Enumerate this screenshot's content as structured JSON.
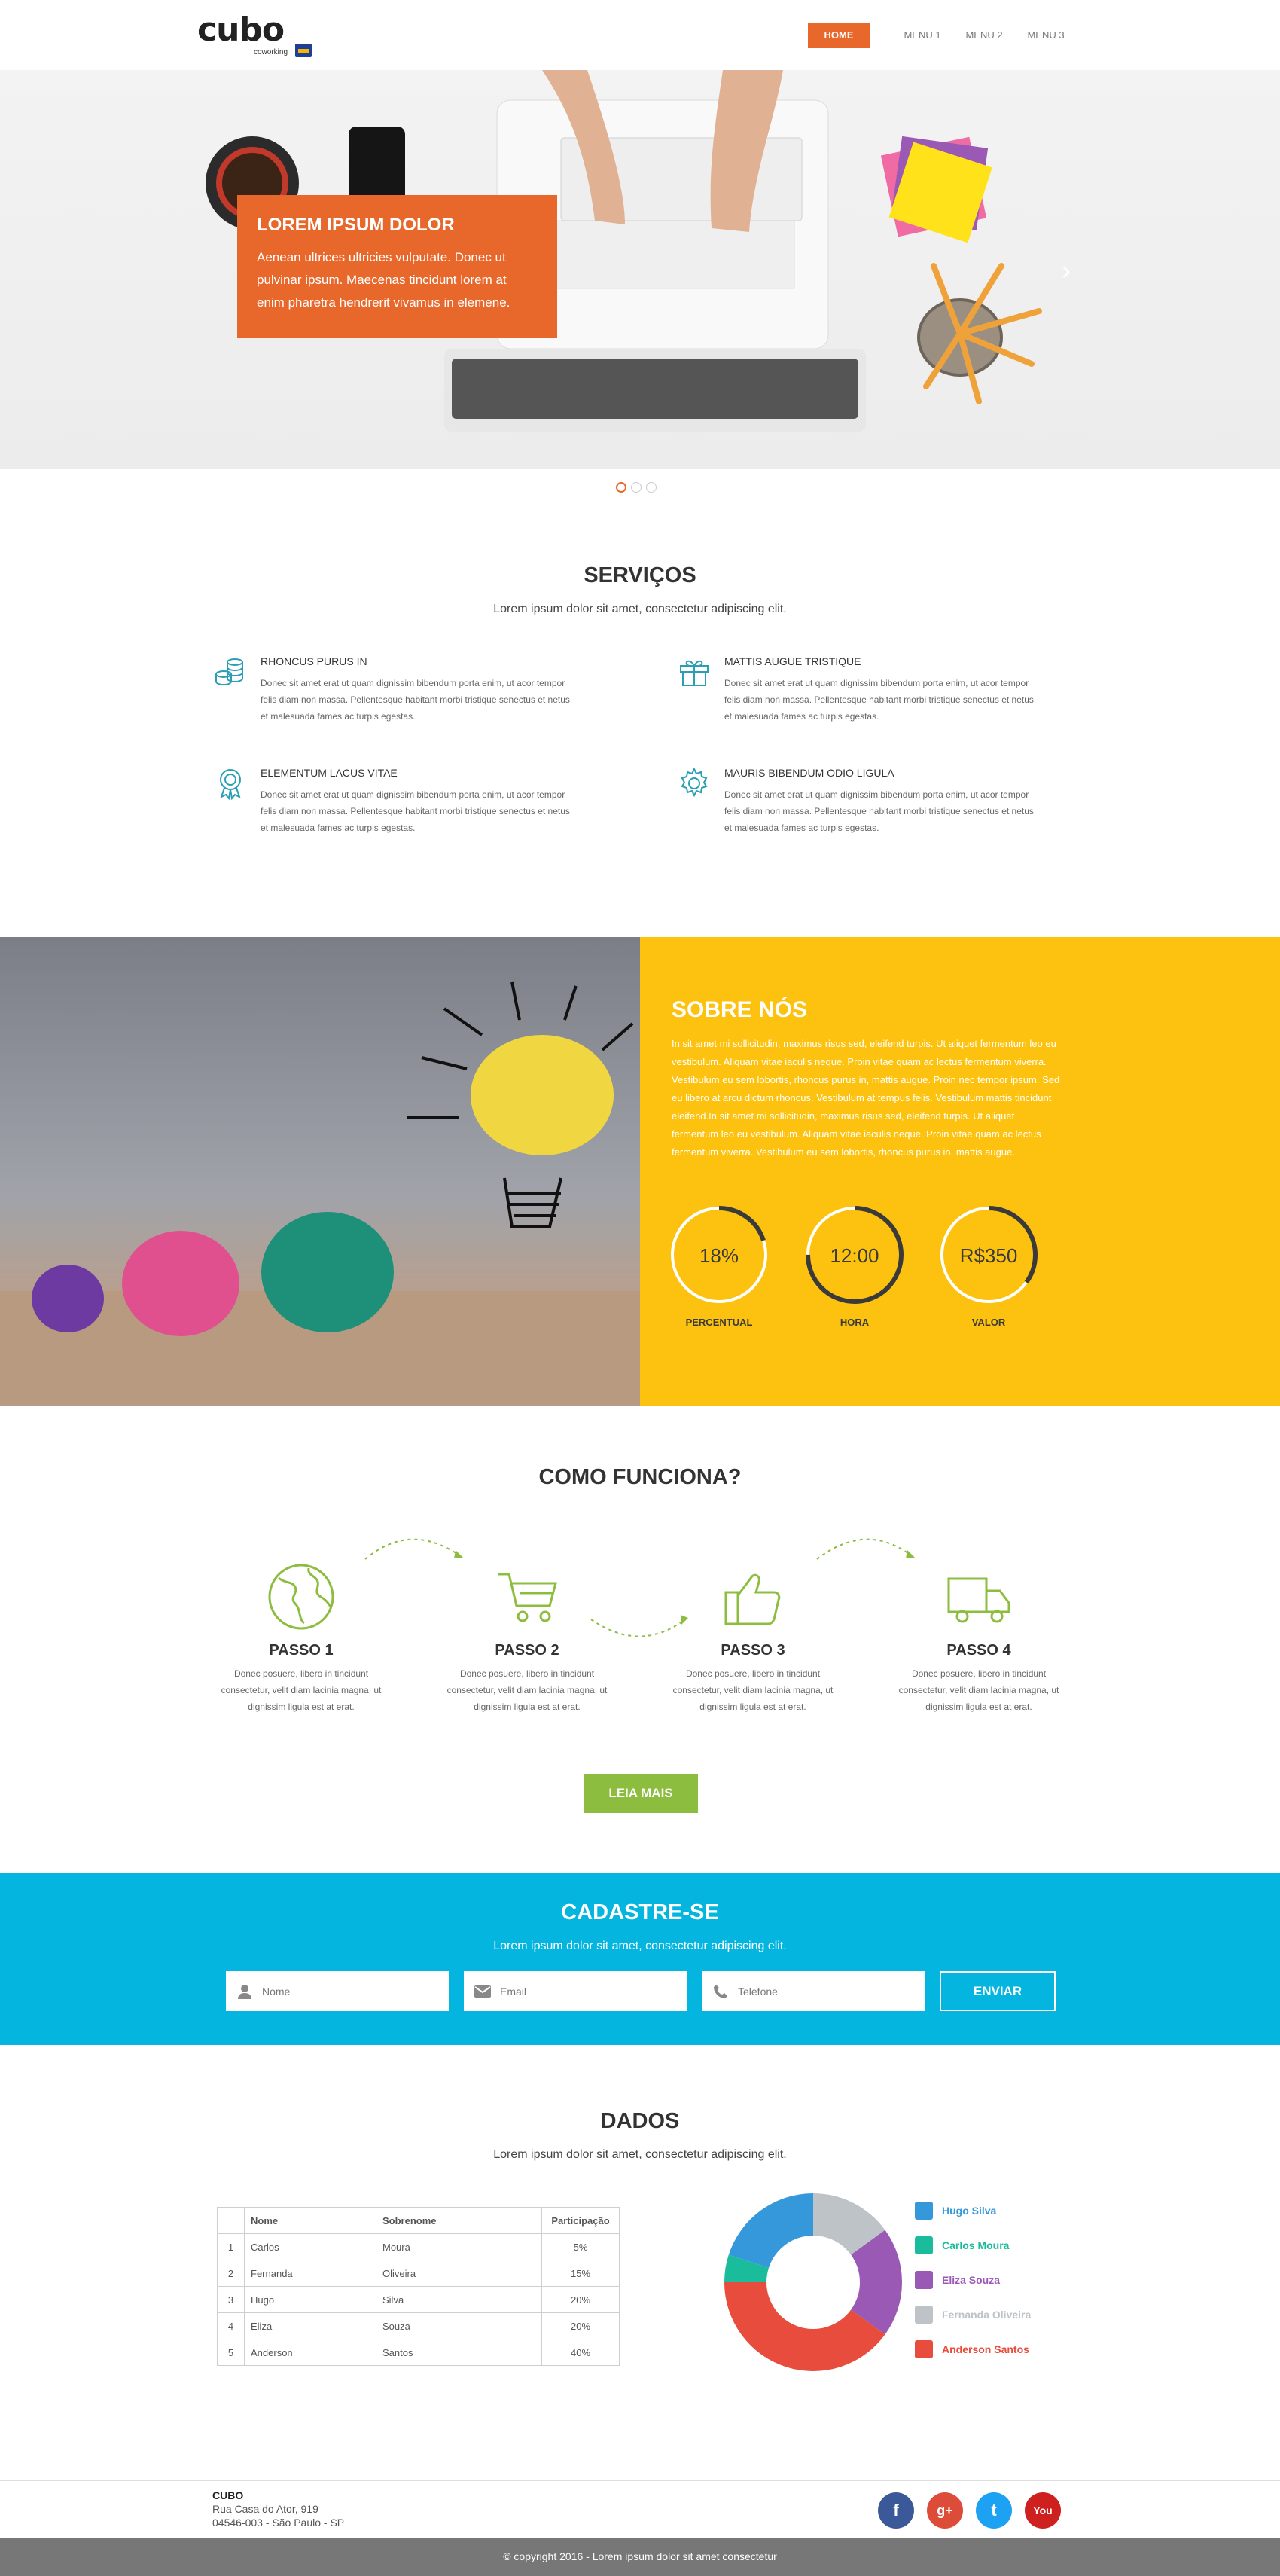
{
  "brand": {
    "name": "cubo",
    "tagline": "coworking"
  },
  "nav": {
    "items": [
      "HOME",
      "MENU 1",
      "MENU 2",
      "MENU 3"
    ]
  },
  "hero": {
    "title": "LOREM IPSUM DOLOR",
    "text": "Aenean ultrices ultricies vulputate. Donec ut pulvinar ipsum. Maecenas tincidunt lorem at enim pharetra hendrerit vivamus in elemene.",
    "next_icon": "chevron-right-icon",
    "active_slide": 1,
    "slide_count": 3
  },
  "services": {
    "title": "SERVIÇOS",
    "subtitle": "Lorem ipsum dolor sit amet, consectetur adipiscing elit.",
    "items": [
      {
        "title": "RHONCUS PURUS IN",
        "icon": "coins-icon",
        "text": "Donec sit amet erat ut quam dignissim bibendum porta enim, ut acor tempor felis diam non massa. Pellentesque habitant morbi tristique senectus et netus et malesuada fames ac turpis egestas."
      },
      {
        "title": "MATTIS AUGUE TRISTIQUE",
        "icon": "gift-icon",
        "text": "Donec sit amet erat ut quam dignissim bibendum porta enim, ut acor tempor felis diam non massa. Pellentesque habitant morbi tristique senectus et netus et malesuada fames ac turpis egestas."
      },
      {
        "title": "ELEMENTUM LACUS VITAE",
        "icon": "award-icon",
        "text": "Donec sit amet erat ut quam dignissim bibendum porta enim, ut acor tempor felis diam non massa. Pellentesque habitant morbi tristique senectus et netus et malesuada fames ac turpis egestas."
      },
      {
        "title": "MAURIS BIBENDUM ODIO LIGULA",
        "icon": "gear-icon",
        "text": "Donec sit amet erat ut quam dignissim bibendum porta enim, ut acor tempor felis diam non massa. Pellentesque habitant morbi tristique senectus et netus et malesuada fames ac turpis egestas."
      }
    ]
  },
  "about": {
    "title": "SOBRE NÓS",
    "text": "In sit amet mi sollicitudin, maximus risus sed, eleifend turpis. Ut aliquet fermentum leo eu vestibulum. Aliquam vitae iaculis neque. Proin vitae quam ac lectus fermentum viverra. Vestibulum eu sem lobortis, rhoncus purus in, mattis augue. Proin nec tempor ipsum. Sed eu libero at arcu dictum rhoncus. Vestibulum at tempus felis. Vestibulum mattis tincidunt eleifend.In sit amet mi sollicitudin, maximus risus sed, eleifend turpis. Ut aliquet fermentum leo eu vestibulum. Aliquam vitae iaculis neque. Proin vitae quam ac lectus fermentum viverra. Vestibulum eu sem lobortis, rhoncus purus in, mattis augue.",
    "stats": [
      {
        "value": "18%",
        "label": "PERCENTUAL",
        "fill": 0.2
      },
      {
        "value": "12:00",
        "label": "HORA",
        "fill": 0.75
      },
      {
        "value": "R$350",
        "label": "VALOR",
        "fill": 0.35
      }
    ]
  },
  "how": {
    "title": "COMO FUNCIONA?",
    "steps": [
      {
        "title": "PASSO 1",
        "icon": "globe-icon",
        "text": "Donec posuere, libero in tincidunt consectetur, velit diam lacinia magna, ut dignissim ligula est at erat."
      },
      {
        "title": "PASSO 2",
        "icon": "cart-icon",
        "text": "Donec posuere, libero in tincidunt consectetur, velit diam lacinia magna, ut dignissim ligula est at erat."
      },
      {
        "title": "PASSO 3",
        "icon": "thumbs-up-icon",
        "text": "Donec posuere, libero in tincidunt consectetur, velit diam lacinia magna, ut dignissim ligula est at erat."
      },
      {
        "title": "PASSO 4",
        "icon": "truck-icon",
        "text": "Donec posuere, libero in tincidunt consectetur, velit diam lacinia magna, ut dignissim ligula est at erat."
      }
    ],
    "button": "LEIA MAIS"
  },
  "signup": {
    "title": "CADASTRE-SE",
    "subtitle": "Lorem ipsum dolor sit amet, consectetur adipiscing elit.",
    "fields": [
      {
        "placeholder": "Nome",
        "icon": "user-icon"
      },
      {
        "placeholder": "Email",
        "icon": "mail-icon"
      },
      {
        "placeholder": "Telefone",
        "icon": "phone-icon"
      }
    ],
    "button": "ENVIAR"
  },
  "dados": {
    "title": "DADOS",
    "subtitle": "Lorem ipsum dolor sit amet, consectetur adipiscing elit.",
    "table": {
      "headers": [
        "",
        "Nome",
        "Sobrenome",
        "Participação"
      ],
      "rows": [
        [
          "1",
          "Carlos",
          "Moura",
          "5%"
        ],
        [
          "2",
          "Fernanda",
          "Oliveira",
          "15%"
        ],
        [
          "3",
          "Hugo",
          "Silva",
          "20%"
        ],
        [
          "4",
          "Eliza",
          "Souza",
          "20%"
        ],
        [
          "5",
          "Anderson",
          "Santos",
          "40%"
        ]
      ]
    }
  },
  "chart_data": {
    "type": "pie",
    "categories": [
      "Hugo Silva",
      "Carlos Moura",
      "Eliza Souza",
      "Fernanda Oliveira",
      "Anderson Santos"
    ],
    "values": [
      20,
      5,
      20,
      15,
      40
    ],
    "colors": [
      "#3498db",
      "#1abc9c",
      "#9b59b6",
      "#bdc3c7",
      "#e74c3c"
    ],
    "legend": "right"
  },
  "footer": {
    "company": "CUBO",
    "address1": "Rua Casa do Ator, 919",
    "address2": "04546-003 - São Paulo - SP",
    "social": [
      {
        "icon": "facebook-icon",
        "glyph": "f",
        "color": "#3b5998"
      },
      {
        "icon": "google-plus-icon",
        "glyph": "g+",
        "color": "#dd4b39"
      },
      {
        "icon": "twitter-icon",
        "glyph": "t",
        "color": "#1da1f2"
      },
      {
        "icon": "youtube-icon",
        "glyph": "You",
        "color": "#cd201f"
      }
    ],
    "copyright": "© copyright 2016 - Lorem ipsum dolor sit amet consectetur"
  }
}
